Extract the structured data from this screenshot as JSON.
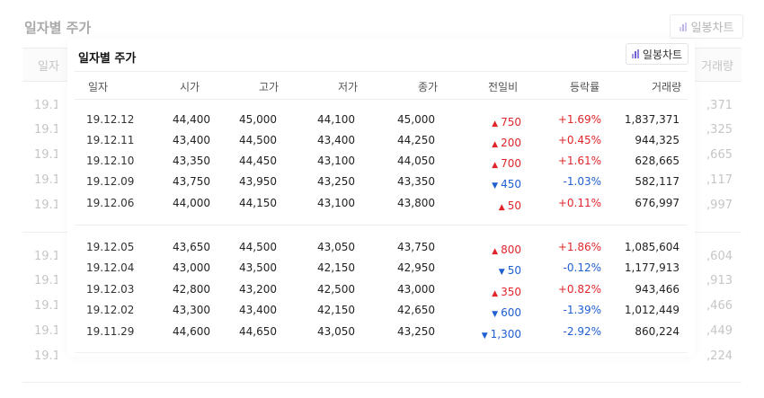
{
  "background": {
    "title": "일자별 주가",
    "chart_button": "일봉차트",
    "header_left": "일자",
    "header_right": "거래량",
    "rows": [
      {
        "date": "19.12.12",
        "volume": "1,837,371"
      },
      {
        "date": "19.12.11",
        "volume": "944,325"
      },
      {
        "date": "19.12.10",
        "volume": "628,665"
      },
      {
        "date": "19.12.09",
        "volume": "582,117"
      },
      {
        "date": "19.12.06",
        "volume": "676,997"
      },
      {
        "date": "19.12.05",
        "volume": "1,085,604"
      },
      {
        "date": "19.12.04",
        "volume": "1,177,913"
      },
      {
        "date": "19.12.03",
        "volume": "943,466"
      },
      {
        "date": "19.12.02",
        "volume": "1,012,449"
      },
      {
        "date": "19.11.29",
        "volume": "860,224"
      }
    ]
  },
  "widget": {
    "title": "일자별 주가",
    "chart_button": "일봉차트",
    "columns": [
      "일자",
      "시가",
      "고가",
      "저가",
      "종가",
      "전일비",
      "등락률",
      "거래량"
    ],
    "rows": [
      {
        "date": "19.12.12",
        "open": "44,400",
        "high": "45,000",
        "low": "44,100",
        "close": "45,000",
        "dir": "up",
        "change": "750",
        "rate": "+1.69%",
        "volume": "1,837,371"
      },
      {
        "date": "19.12.11",
        "open": "43,400",
        "high": "44,500",
        "low": "43,400",
        "close": "44,250",
        "dir": "up",
        "change": "200",
        "rate": "+0.45%",
        "volume": "944,325"
      },
      {
        "date": "19.12.10",
        "open": "43,350",
        "high": "44,450",
        "low": "43,100",
        "close": "44,050",
        "dir": "up",
        "change": "700",
        "rate": "+1.61%",
        "volume": "628,665"
      },
      {
        "date": "19.12.09",
        "open": "43,750",
        "high": "43,950",
        "low": "43,250",
        "close": "43,350",
        "dir": "down",
        "change": "450",
        "rate": "-1.03%",
        "volume": "582,117"
      },
      {
        "date": "19.12.06",
        "open": "44,000",
        "high": "44,150",
        "low": "43,100",
        "close": "43,800",
        "dir": "up",
        "change": "50",
        "rate": "+0.11%",
        "volume": "676,997"
      },
      {
        "date": "19.12.05",
        "open": "43,650",
        "high": "44,500",
        "low": "43,050",
        "close": "43,750",
        "dir": "up",
        "change": "800",
        "rate": "+1.86%",
        "volume": "1,085,604"
      },
      {
        "date": "19.12.04",
        "open": "43,000",
        "high": "43,500",
        "low": "42,150",
        "close": "42,950",
        "dir": "down",
        "change": "50",
        "rate": "-0.12%",
        "volume": "1,177,913"
      },
      {
        "date": "19.12.03",
        "open": "42,800",
        "high": "43,200",
        "low": "42,500",
        "close": "43,000",
        "dir": "up",
        "change": "350",
        "rate": "+0.82%",
        "volume": "943,466"
      },
      {
        "date": "19.12.02",
        "open": "43,300",
        "high": "43,400",
        "low": "42,150",
        "close": "42,650",
        "dir": "down",
        "change": "600",
        "rate": "-1.39%",
        "volume": "1,012,449"
      },
      {
        "date": "19.11.29",
        "open": "44,600",
        "high": "44,650",
        "low": "43,050",
        "close": "43,250",
        "dir": "down",
        "change": "1,300",
        "rate": "-2.92%",
        "volume": "860,224"
      }
    ]
  },
  "icons": {
    "chart_icon": "bar-chart-icon",
    "up_arrow": "▲",
    "down_arrow": "▼"
  },
  "colors": {
    "up": "#e0262b",
    "down": "#1f5fd1",
    "chart_icon": "#6a5cd6"
  }
}
